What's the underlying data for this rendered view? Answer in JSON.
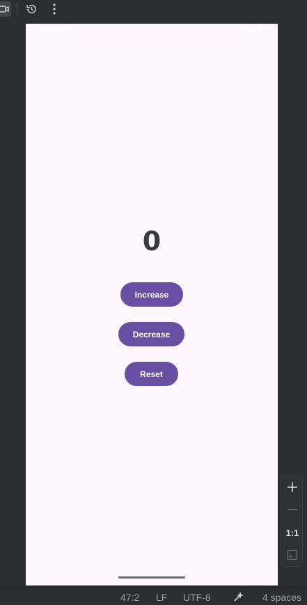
{
  "toolbar": {
    "icons": [
      "camera-icon",
      "history-icon",
      "more-vert-icon"
    ]
  },
  "device": {
    "status": {
      "time": "10:53 AM"
    },
    "counter_value": "0",
    "buttons": {
      "increase": "Increase",
      "decrease": "Decrease",
      "reset": "Reset"
    }
  },
  "zoom": {
    "zoom_in": "+",
    "zoom_out": "—",
    "actual_size": "1:1"
  },
  "statusbar": {
    "position": "47:2",
    "line_ending": "LF",
    "encoding": "UTF-8",
    "indent": "4 spaces"
  },
  "colors": {
    "accent": "#6750a4",
    "device_bg": "#fef7fd",
    "ide_bg": "#2b2d30"
  }
}
